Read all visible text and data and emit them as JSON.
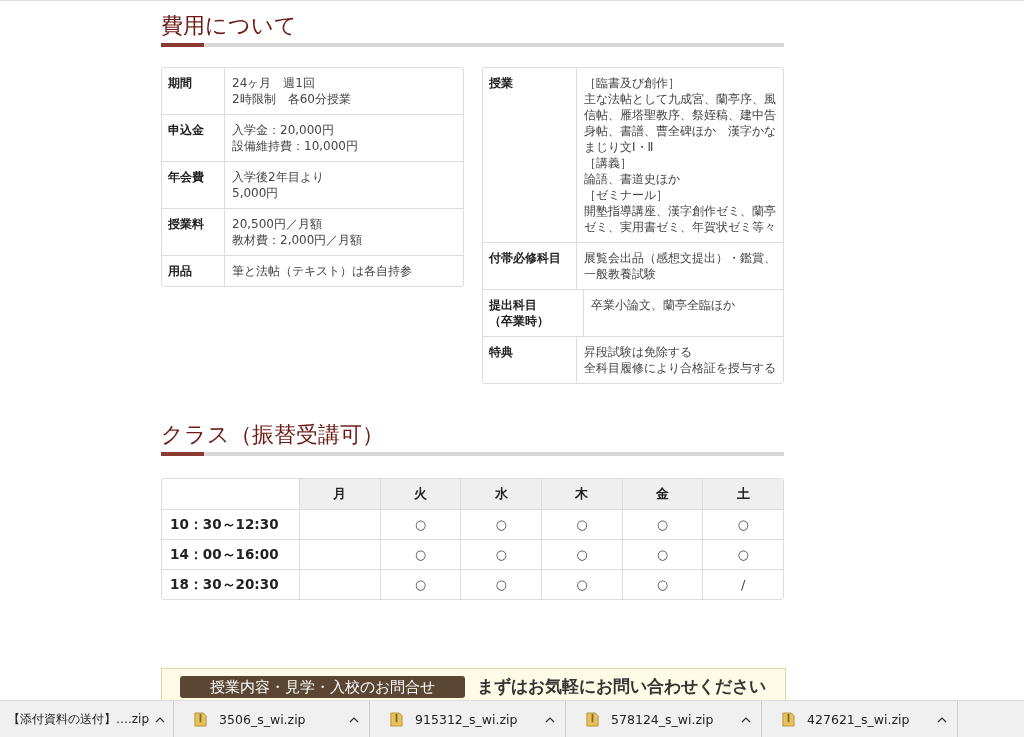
{
  "fees": {
    "title": "費用について",
    "tables": [
      {
        "rows": [
          {
            "label": "期間",
            "lines": [
              "24ヶ月　週1回",
              "2時限制　各60分授業"
            ]
          },
          {
            "label": "申込金",
            "lines": [
              "入学金：20,000円",
              "設備維持費：10,000円"
            ]
          },
          {
            "label": "年会費",
            "lines": [
              "入学後2年目より",
              "5,000円"
            ]
          },
          {
            "label": "授業料",
            "lines": [
              "20,500円／月額",
              "教材費：2,000円／月額"
            ]
          },
          {
            "label": "用品",
            "lines": [
              "筆と法帖（テキスト）は各自持参"
            ]
          }
        ]
      },
      {
        "rows": [
          {
            "label": "授業",
            "lines": [
              "［臨書及び創作］",
              "主な法帖として九成宮、蘭亭序、風",
              "信帖、雁塔聖教序、祭姪稿、建中告",
              "身帖、書譜、曹全碑ほか　漢字かな",
              "まじり文Ⅰ・Ⅱ",
              "［講義］",
              "論語、書道史ほか",
              "［ゼミナール］",
              "開塾指導講座、漢字創作ゼミ、蘭亭",
              "ゼミ、実用書ゼミ、年賀状ゼミ等々"
            ]
          },
          {
            "label": "付帯必修科目",
            "lines": [
              "展覧会出品（感想文提出）・鑑賞、",
              "一般教養試験"
            ]
          },
          {
            "label": "提出科目（卒業時）",
            "lines": [
              "卒業小論文、蘭亭全臨ほか"
            ]
          },
          {
            "label": "特典",
            "lines": [
              "昇段試験は免除する",
              "全科目履修により合格証を授与する"
            ]
          }
        ]
      }
    ]
  },
  "classes": {
    "title": "クラス（振替受講可）",
    "columns": [
      "月",
      "火",
      "水",
      "木",
      "金",
      "土"
    ],
    "rows": [
      {
        "time": "10：30～12:30",
        "cells": [
          null,
          "○",
          "○",
          "○",
          "○",
          "○"
        ]
      },
      {
        "time": "14：00～16:00",
        "cells": [
          null,
          "○",
          "○",
          "○",
          "○",
          "○"
        ]
      },
      {
        "time": "18：30～20:30",
        "cells": [
          null,
          "○",
          "○",
          "○",
          "○",
          "/"
        ]
      }
    ]
  },
  "inquiry": {
    "button": "授業内容・見学・入校のお問合せ",
    "message": "まずはお気軽にお問い合わせください"
  },
  "downloads": [
    {
      "name": "【添付資料の送付】….zip",
      "icon": false
    },
    {
      "name": "3506_s_wi.zip",
      "icon": true
    },
    {
      "name": "915312_s_wi.zip",
      "icon": true
    },
    {
      "name": "578124_s_wi.zip",
      "icon": true
    },
    {
      "name": "427621_s_wi.zip",
      "icon": true
    }
  ]
}
